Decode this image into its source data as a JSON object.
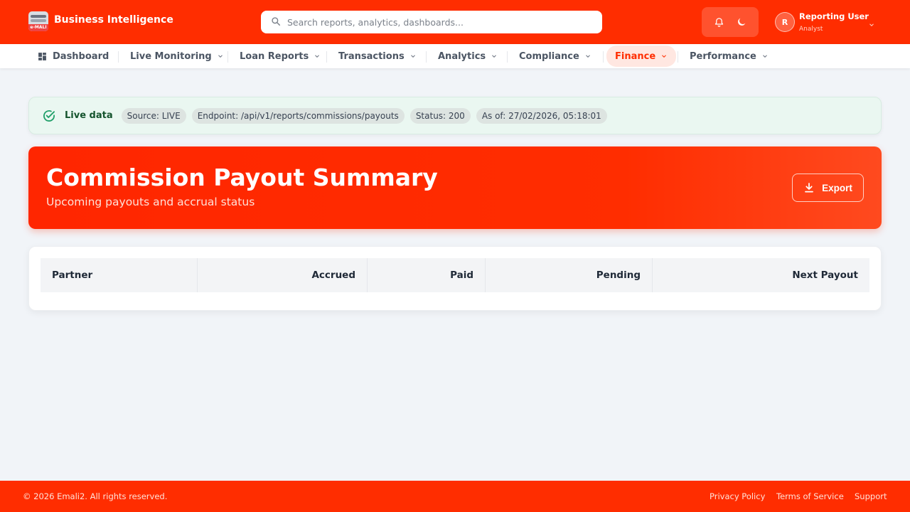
{
  "header": {
    "logo_top_text": "BUSINESS PORTAL",
    "logo_bottom_text": "e-MALI",
    "brand_title": "Business Intelligence",
    "search_placeholder": "Search reports, analytics, dashboards...",
    "icons": [
      "bell-icon",
      "moon-icon"
    ],
    "user": {
      "initial": "R",
      "name": "Reporting User",
      "role": "Analyst"
    }
  },
  "nav": {
    "items": [
      {
        "label": "Dashboard",
        "icon": "grid-icon",
        "has_menu": false,
        "active": false
      },
      {
        "label": "Live Monitoring",
        "has_menu": true,
        "active": false
      },
      {
        "label": "Loan Reports",
        "has_menu": true,
        "active": false
      },
      {
        "label": "Transactions",
        "has_menu": true,
        "active": false
      },
      {
        "label": "Analytics",
        "has_menu": true,
        "active": false
      },
      {
        "label": "Compliance",
        "has_menu": true,
        "active": false
      },
      {
        "label": "Finance",
        "has_menu": true,
        "active": true
      },
      {
        "label": "Performance",
        "has_menu": true,
        "active": false
      }
    ]
  },
  "live_status": {
    "label": "Live data",
    "source": "Source: LIVE",
    "endpoint": "Endpoint: /api/v1/reports/commissions/payouts",
    "status": "Status: 200",
    "as_of": "As of: 27/02/2026, 05:18:01"
  },
  "hero": {
    "title": "Commission Payout Summary",
    "subtitle": "Upcoming payouts and accrual status",
    "export_label": "Export"
  },
  "table": {
    "columns": [
      "Partner",
      "Accrued",
      "Paid",
      "Pending",
      "Next Payout"
    ],
    "rows": []
  },
  "footer": {
    "copyright": "© 2026 Emali2. All rights reserved.",
    "links": [
      "Privacy Policy",
      "Terms of Service",
      "Support"
    ]
  },
  "colors": {
    "primary": "#ff2d00",
    "page_bg": "#f1f4f8",
    "live_bg": "#eaf7f1",
    "live_icon": "#22a06b"
  }
}
